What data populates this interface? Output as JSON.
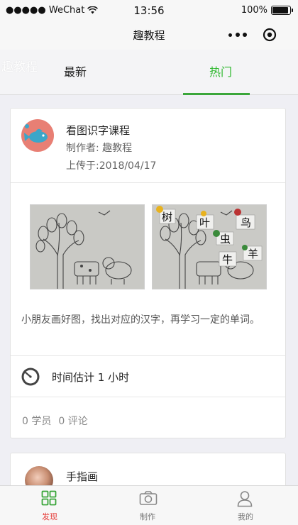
{
  "status_bar": {
    "carrier": "●●●●● WeChat",
    "time": "13:56",
    "battery": "100%",
    "battery_level": 1.0
  },
  "nav_bar": {
    "title": "趣教程",
    "icons": [
      "more-dots-icon",
      "close-circle-icon"
    ]
  },
  "watermark": "趣教程",
  "tabs": [
    {
      "label": "最新",
      "active": false
    },
    {
      "label": "热门",
      "active": true
    }
  ],
  "accent_color": "#2eb82e",
  "courses": [
    {
      "title": "看图识字课程",
      "author": "制作者: 趣教程",
      "upload_date": "上传于:2018/04/17",
      "description": "小朋友画好图，找出对应的汉字，再学习一定的单词。",
      "duration": "时间估计 1 小时",
      "students": "0 学员",
      "comments": "0 评论",
      "image_labels": [
        "树",
        "叶",
        "鸟",
        "虫",
        "羊",
        "牛"
      ]
    },
    {
      "title": "手指画"
    }
  ],
  "bottom_tabs": [
    {
      "label": "发现",
      "icon": "grid-icon",
      "active": true
    },
    {
      "label": "制作",
      "icon": "camera-icon",
      "active": false
    },
    {
      "label": "我的",
      "icon": "person-icon",
      "active": false
    }
  ]
}
